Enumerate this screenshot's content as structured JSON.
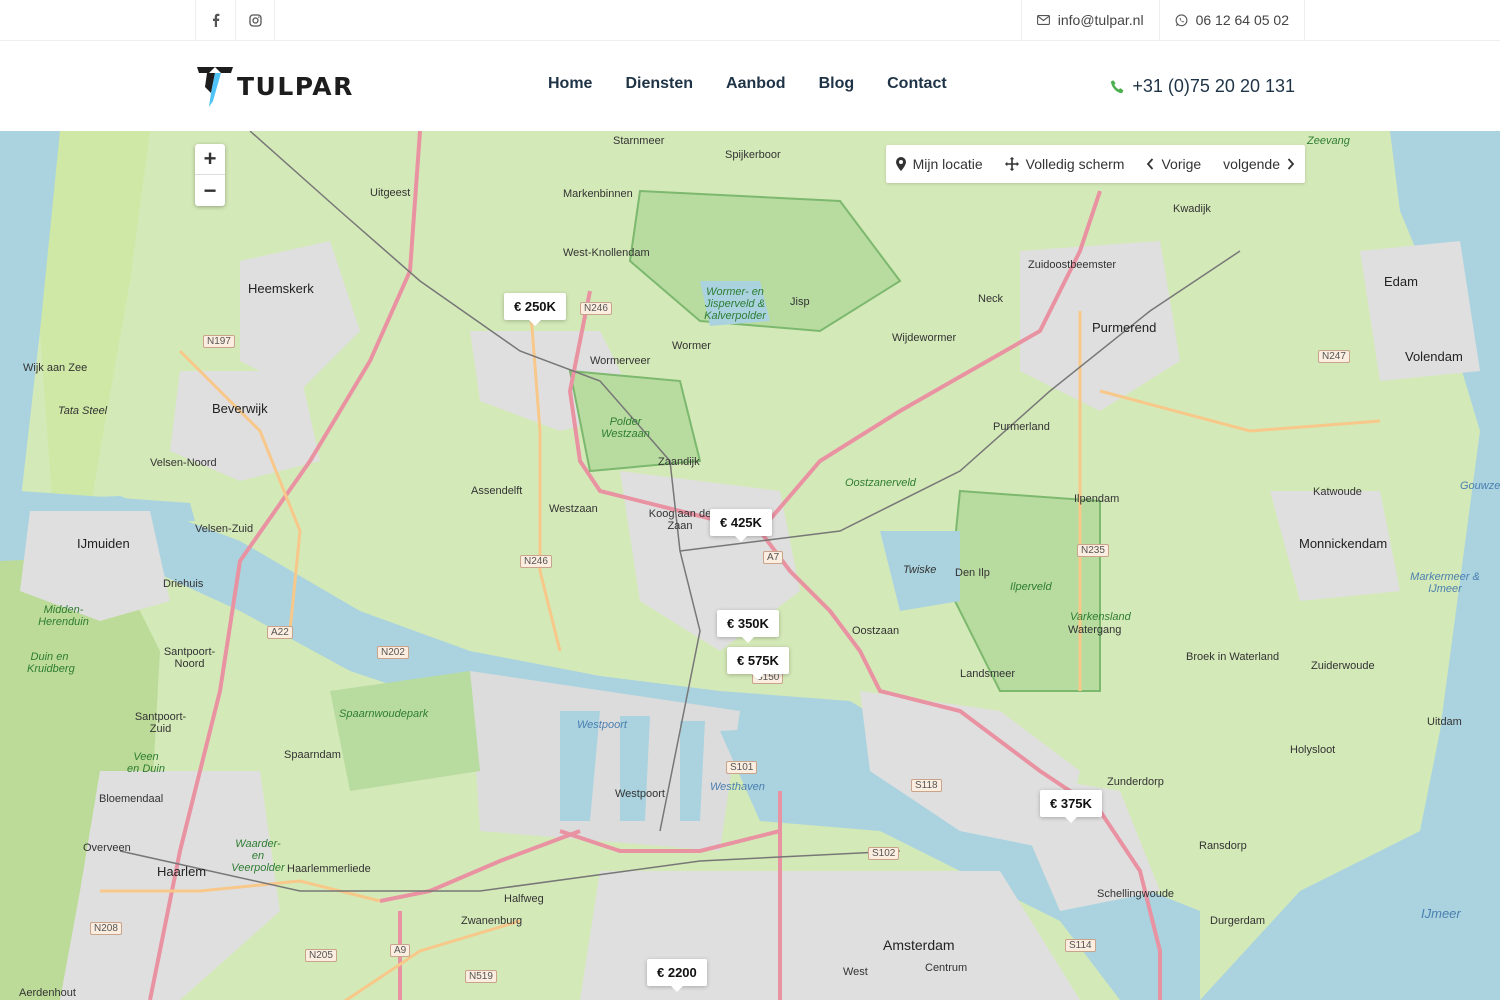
{
  "topbar": {
    "email": "info@tulpar.nl",
    "whatsapp": "06 12 64 05 02"
  },
  "header": {
    "logo_text": "TULPAR",
    "nav": [
      "Home",
      "Diensten",
      "Aanbod",
      "Blog",
      "Contact"
    ],
    "phone": "+31 (0)75 20 20 131"
  },
  "map": {
    "zoom_in": "+",
    "zoom_out": "−",
    "controls": {
      "my_location": "Mijn locatie",
      "fullscreen": "Volledig scherm",
      "previous": "Vorige",
      "next": "volgende"
    },
    "pins": [
      "€ 250K",
      "€ 425K",
      "€ 350K",
      "€ 575K",
      "€ 375K",
      "€ 2200"
    ],
    "places": {
      "starnmeer": "Starnmeer",
      "spijkerboor": "Spijkerboor",
      "uitgeest": "Uitgeest",
      "markenbinnen": "Markenbinnen",
      "heemskerk": "Heemskerk",
      "west_knollendam": "West-Knollendam",
      "wormer_jisp": "Wormer- en Jisperveld & Kalverpolder",
      "kwadijk": "Kwadijk",
      "zuidoostbeemster": "Zuidoostbeemster",
      "edam": "Edam",
      "neck": "Neck",
      "jisp": "Jisp",
      "purmerend": "Purmerend",
      "volendam": "Volendam",
      "wormerveer": "Wormerveer",
      "wormer": "Wormer",
      "wijdewormer": "Wijdewormer",
      "wijk_aan_zee": "Wijk aan Zee",
      "tata_steel": "Tata Steel",
      "beverwijk": "Beverwijk",
      "polder_westzaan": "Polder Westzaan",
      "purmerland": "Purmerland",
      "velsen_noord": "Velsen-Noord",
      "zaandijk": "Zaandijk",
      "oostzanerveld": "Oostzanerveld",
      "assendelft": "Assendelft",
      "ilpendam": "Ilpendam",
      "katwoude": "Katwoude",
      "westzaan": "Westzaan",
      "koog": "Koog aan de Zaan",
      "velsen_zuid": "Velsen-Zuid",
      "ijmuiden": "IJmuiden",
      "monnickendam": "Monnickendam",
      "twiske": "Twiske",
      "den_ilp": "Den Ilp",
      "ilperveld": "Ilperveld",
      "driehuis": "Driehuis",
      "markermeer": "Markermeer & IJmeer",
      "varkensland": "Varkensland",
      "watergang": "Watergang",
      "oostzaan": "Oostzaan",
      "midden_herenduin": "Midden-Herenduin",
      "santpoort_noord": "Santpoort-Noord",
      "broek": "Broek in Waterland",
      "zuiderwoude": "Zuiderwoude",
      "landsmeer": "Landsmeer",
      "kruidberg": "Duin en Kruidberg",
      "spaarnwoudepark": "Spaarnwoudepark",
      "santpoort_zuid": "Santpoort-Zuid",
      "westpoort_top": "Westpoort",
      "uitdam": "Uitdam",
      "holysloot": "Holysloot",
      "spaarndam": "Spaarndam",
      "zunderdorp": "Zunderdorp",
      "veen_en_duin": "Veen en Duin",
      "westhaven": "Westhaven",
      "bloemendaal": "Bloemendaal",
      "westpoort": "Westpoort",
      "ransdorp": "Ransdorp",
      "overveen": "Overveen",
      "waarder": "Waarder- en Veerpolder",
      "haarlem": "Haarlem",
      "haarlemmerliede": "Haarlemmerliede",
      "halfweg": "Halfweg",
      "schellingwoude": "Schellingwoude",
      "ijmeer": "IJmeer",
      "durgerdam": "Durgerdam",
      "zwanenburg": "Zwanenburg",
      "amsterdam": "Amsterdam",
      "aerdenhout": "Aerdenhout",
      "west": "West",
      "centrum": "Centrum",
      "zeevang": "Zeevang",
      "gouwzee": "Gouwzee"
    },
    "roads": [
      "N246",
      "N197",
      "N247",
      "N246",
      "A7",
      "N235",
      "A22",
      "N202",
      "S150",
      "S101",
      "S118",
      "S102",
      "N208",
      "N205",
      "A9",
      "N519",
      "S114"
    ]
  },
  "colors": {
    "nav_text": "#1f3346",
    "land": "#d4e9b8",
    "water": "#aad3df",
    "motorway": "#e892a2",
    "primary": "#fcd6a4",
    "urban": "#e0dfdf"
  }
}
